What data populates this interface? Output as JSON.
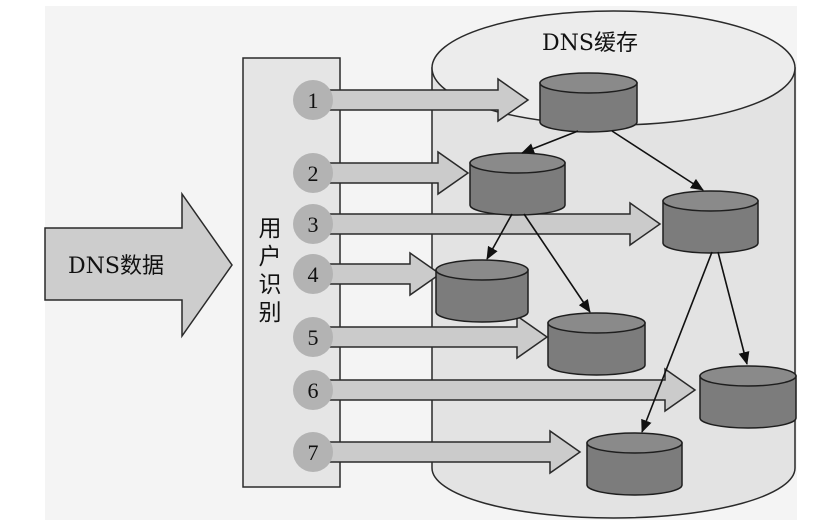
{
  "source": {
    "label": "DNS数据"
  },
  "identifier": {
    "label": "用户识别"
  },
  "cache": {
    "label": "DNS缓存"
  },
  "steps": [
    {
      "label": "1"
    },
    {
      "label": "2"
    },
    {
      "label": "3"
    },
    {
      "label": "4"
    },
    {
      "label": "5"
    },
    {
      "label": "6"
    },
    {
      "label": "7"
    }
  ]
}
